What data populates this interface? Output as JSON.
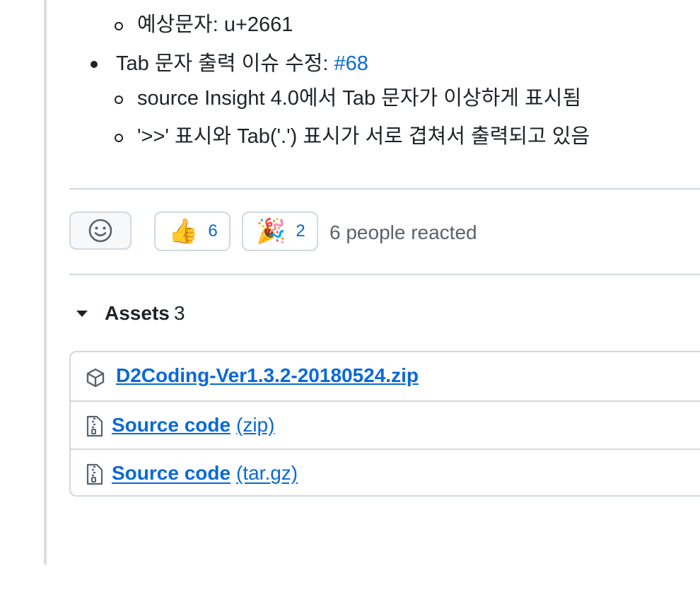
{
  "release_notes": {
    "items": [
      {
        "level": "sub",
        "text": "예상문자: u+2661"
      },
      {
        "level": "main",
        "text": "Tab 문자 출력 이슈 수정: ",
        "link": "#68"
      },
      {
        "level": "sub",
        "text": "source Insight 4.0에서 Tab 문자가 이상하게 표시됨"
      },
      {
        "level": "sub",
        "text": "'>>' 표시와 Tab('.') 표시가 서로 겹쳐서 출력되고 있음"
      }
    ]
  },
  "reactions": {
    "items": [
      {
        "emoji": "👍",
        "icon": "thumbs-up-icon",
        "count": "6"
      },
      {
        "emoji": "🎉",
        "icon": "party-popper-icon",
        "count": "2"
      }
    ],
    "summary": "6 people reacted"
  },
  "assets": {
    "title": "Assets",
    "count": "3",
    "files": [
      {
        "name": "D2Coding-Ver1.3.2-20180524.zip",
        "ext": "",
        "icon": "package-icon"
      },
      {
        "name": "Source code",
        "ext": "(zip)",
        "icon": "file-zip-icon"
      },
      {
        "name": "Source code",
        "ext": "(tar.gz)",
        "icon": "file-zip-icon"
      }
    ]
  },
  "colors": {
    "link": "#0969da",
    "text": "#1f2328",
    "muted": "#59636e",
    "border": "#d1d9e0"
  }
}
